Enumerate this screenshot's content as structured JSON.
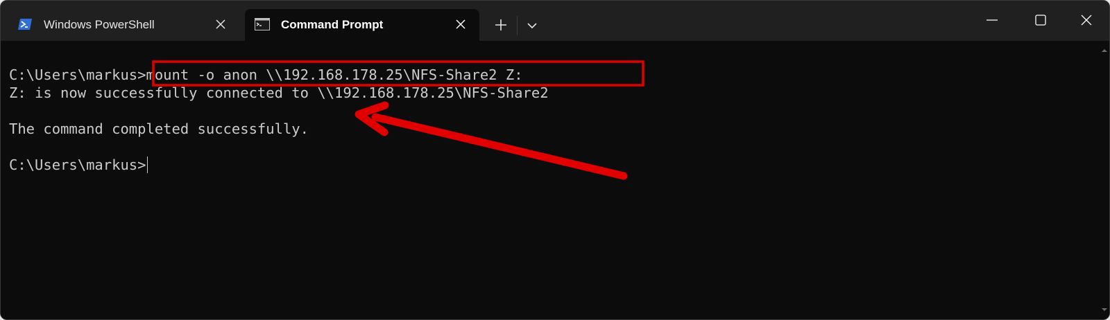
{
  "tabs": [
    {
      "label": "Windows PowerShell",
      "icon": "powershell-icon",
      "active": false
    },
    {
      "label": "Command Prompt",
      "icon": "cmd-icon",
      "active": true
    }
  ],
  "titlebar": {
    "new_tab_icon": "plus-icon",
    "dropdown_icon": "chevron-down-icon",
    "minimize_icon": "minimize-icon",
    "maximize_icon": "maximize-icon",
    "close_icon": "close-icon"
  },
  "terminal": {
    "prompt": "C:\\Users\\markus>",
    "command": "mount -o anon \\\\192.168.178.25\\NFS-Share2 Z:",
    "output_line1": "Z: is now successfully connected to \\\\192.168.178.25\\NFS-Share2",
    "output_line2": "The command completed successfully.",
    "prompt2": "C:\\Users\\markus>"
  },
  "colors": {
    "terminal_bg": "#0c0c0c",
    "titlebar_bg": "#202020",
    "text": "#cccccc",
    "annotation_red": "#e00000",
    "powershell_blue": "#2f6fd6"
  },
  "annotation": {
    "highlight": "red-rectangle-around-command",
    "pointer": "red-arrow-to-output"
  }
}
